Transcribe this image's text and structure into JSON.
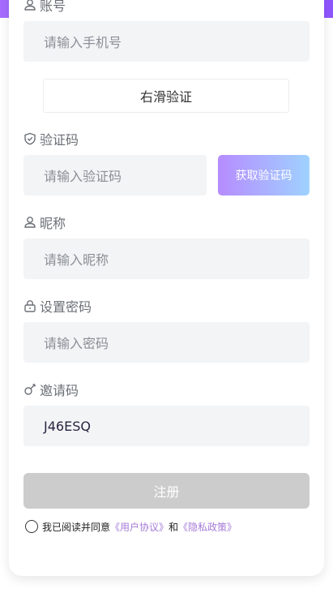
{
  "account": {
    "label": "账号",
    "placeholder": "请输入手机号"
  },
  "slider": {
    "text": "右滑验证"
  },
  "verify": {
    "label": "验证码",
    "placeholder": "请输入验证码",
    "button": "获取验证码"
  },
  "nickname": {
    "label": "昵称",
    "placeholder": "请输入昵称"
  },
  "password": {
    "label": "设置密码",
    "placeholder": "请输入密码"
  },
  "invite": {
    "label": "邀请码",
    "value": "J46ESQ"
  },
  "register": {
    "label": "注册"
  },
  "agreement": {
    "prefix": "我已阅读并同意",
    "user_agreement": "《用户协议》",
    "and": "和",
    "privacy_policy": "《隐私政策》"
  },
  "colors": {
    "accent_gradient_start": "#b68cff",
    "accent_gradient_end": "#9fd2ff",
    "top_strip": "#9a5dff",
    "link": "#a57bd8",
    "disabled_button": "#cccccc"
  },
  "icons": [
    "user-icon",
    "shield-icon",
    "user-icon",
    "lock-icon",
    "key-icon"
  ]
}
